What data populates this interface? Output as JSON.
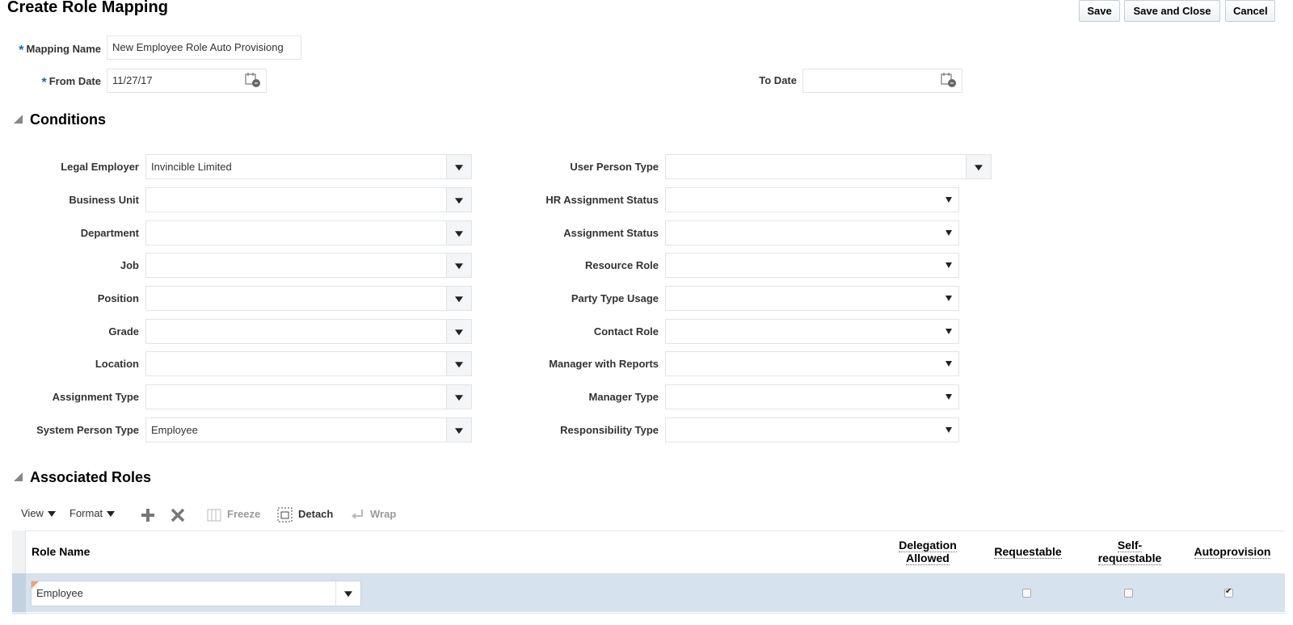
{
  "page": {
    "title": "Create Role Mapping"
  },
  "toolbar": {
    "save": "Save",
    "save_and_close": "Save and Close",
    "cancel": "Cancel"
  },
  "header": {
    "required_mark": "*",
    "mapping_name": {
      "label": "Mapping Name",
      "value": "New Employee Role Auto Provisiong"
    },
    "from_date": {
      "label": "From Date",
      "value": "11/27/17"
    },
    "to_date": {
      "label": "To Date",
      "value": ""
    }
  },
  "conditions": {
    "title": "Conditions",
    "left": [
      {
        "label": "Legal Employer",
        "value": "Invincible Limited"
      },
      {
        "label": "Business Unit",
        "value": ""
      },
      {
        "label": "Department",
        "value": ""
      },
      {
        "label": "Job",
        "value": ""
      },
      {
        "label": "Position",
        "value": ""
      },
      {
        "label": "Grade",
        "value": ""
      },
      {
        "label": "Location",
        "value": ""
      },
      {
        "label": "Assignment Type",
        "value": ""
      },
      {
        "label": "System Person Type",
        "value": "Employee"
      }
    ],
    "right": [
      {
        "label": "User Person Type",
        "value": ""
      },
      {
        "label": "HR Assignment Status",
        "value": ""
      },
      {
        "label": "Assignment Status",
        "value": ""
      },
      {
        "label": "Resource Role",
        "value": ""
      },
      {
        "label": "Party Type Usage",
        "value": ""
      },
      {
        "label": "Contact Role",
        "value": ""
      },
      {
        "label": "Manager with Reports",
        "value": ""
      },
      {
        "label": "Manager Type",
        "value": ""
      },
      {
        "label": "Responsibility Type",
        "value": ""
      }
    ]
  },
  "roles": {
    "title": "Associated Roles",
    "toolbar": {
      "view": "View",
      "format": "Format",
      "freeze": "Freeze",
      "detach": "Detach",
      "wrap": "Wrap"
    },
    "columns": {
      "role_name": "Role Name",
      "delegation_1": "Delegation",
      "delegation_2": "Allowed",
      "requestable": "Requestable",
      "self_1": "Self-",
      "self_2": "requestable",
      "autoprovision": "Autoprovision"
    },
    "rows": [
      {
        "role_name": "Employee",
        "requestable": false,
        "self_requestable": false,
        "autoprovision": true
      }
    ]
  },
  "colors": {
    "selected_row": "#d6e2ee",
    "required": "#1a63b6"
  }
}
